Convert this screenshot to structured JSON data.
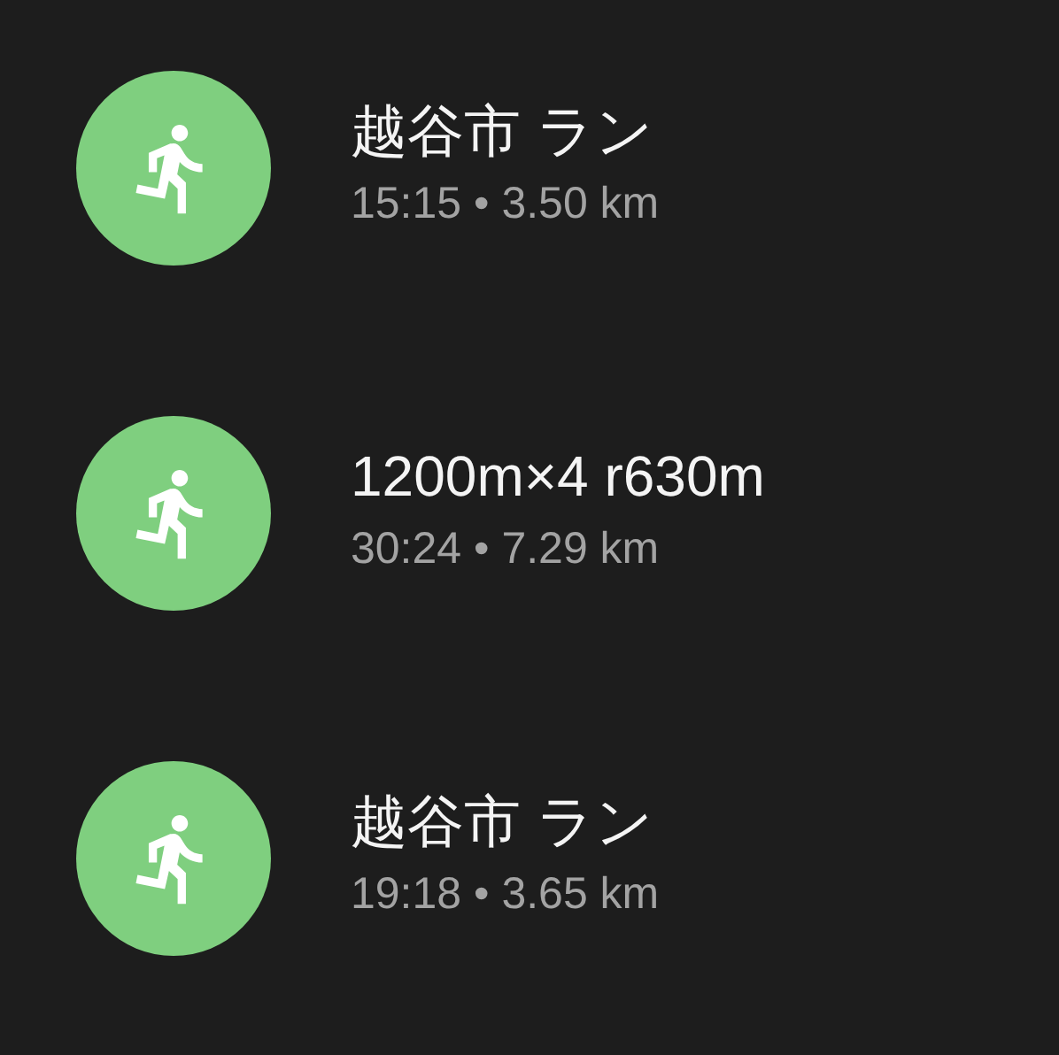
{
  "activities": [
    {
      "title": "越谷市 ラン",
      "stats": "15:15 • 3.50 km"
    },
    {
      "title": "1200m×4 r630m",
      "stats": "30:24 • 7.29 km"
    },
    {
      "title": "越谷市 ラン",
      "stats": "19:18 • 3.65 km"
    }
  ]
}
